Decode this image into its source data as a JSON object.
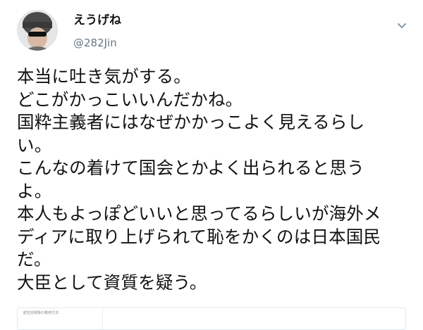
{
  "tweet": {
    "author": {
      "display_name": "えうげね",
      "handle": "@282Jin",
      "avatar_icon": "user-avatar"
    },
    "menu_icon": "chevron-down-icon",
    "text_lines": [
      "本当に吐き気がする。",
      "どこがかっこいいんだかね。",
      "国粋主義者にはなぜかかっこよく見えるらし",
      "い。",
      "こんなの着けて国会とかよく出られると思う",
      "よ。",
      "本人もよっぽどいいと思ってるらしいが海外メ",
      "ディアに取り上げられて恥をかくのは日本国民",
      "だ。",
      "大臣として資質を疑う。"
    ],
    "attachment": {
      "caption": "航空自衛隊の着用方法"
    }
  },
  "colors": {
    "text": "#14171a",
    "secondary": "#657786",
    "border": "#e1e8ed"
  }
}
